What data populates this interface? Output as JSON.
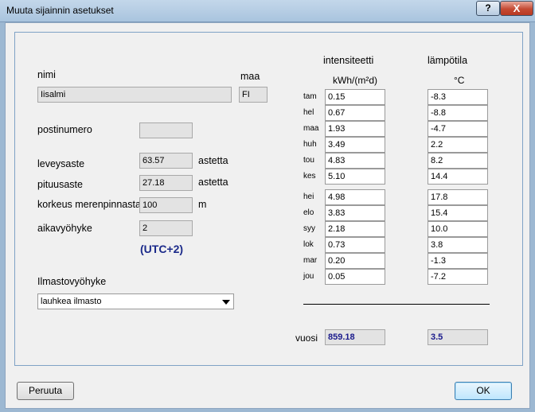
{
  "window": {
    "title": "Muuta sijainnin asetukset",
    "help_label": "?",
    "close_label": "X"
  },
  "form": {
    "name_label": "nimi",
    "name_value": "Iisalmi",
    "country_label": "maa",
    "country_value": "FI",
    "postal_label": "postinumero",
    "postal_value": "",
    "lat_label": "leveysaste",
    "lat_value": "63.57",
    "lat_unit": "astetta",
    "lon_label": "pituusaste",
    "lon_value": "27.18",
    "lon_unit": "astetta",
    "alt_label": "korkeus merenpinnasta",
    "alt_value": "100",
    "alt_unit": "m",
    "tz_label": "aikavyöhyke",
    "tz_value": "2",
    "tz_display": "(UTC+2)",
    "climate_label": "Ilmastovyöhyke",
    "climate_value": "lauhkea ilmasto"
  },
  "table": {
    "intensity_header": "intensiteetti",
    "intensity_unit": "kWh/(m²d)",
    "temp_header": "lämpötila",
    "temp_unit": "°C",
    "rows": [
      {
        "month": "tam",
        "intensity": "0.15",
        "temp": "-8.3"
      },
      {
        "month": "hel",
        "intensity": "0.67",
        "temp": "-8.8"
      },
      {
        "month": "maa",
        "intensity": "1.93",
        "temp": "-4.7"
      },
      {
        "month": "huh",
        "intensity": "3.49",
        "temp": "2.2"
      },
      {
        "month": "tou",
        "intensity": "4.83",
        "temp": "8.2"
      },
      {
        "month": "kes",
        "intensity": "5.10",
        "temp": "14.4"
      },
      {
        "month": "hei",
        "intensity": "4.98",
        "temp": "17.8"
      },
      {
        "month": "elo",
        "intensity": "3.83",
        "temp": "15.4"
      },
      {
        "month": "syy",
        "intensity": "2.18",
        "temp": "10.0"
      },
      {
        "month": "lok",
        "intensity": "0.73",
        "temp": "3.8"
      },
      {
        "month": "mar",
        "intensity": "0.20",
        "temp": "-1.3"
      },
      {
        "month": "jou",
        "intensity": "0.05",
        "temp": "-7.2"
      }
    ],
    "year_label": "vuosi",
    "year_intensity": "859.18",
    "year_temp": "3.5"
  },
  "buttons": {
    "cancel_label": "Peruuta",
    "ok_label": "OK"
  }
}
